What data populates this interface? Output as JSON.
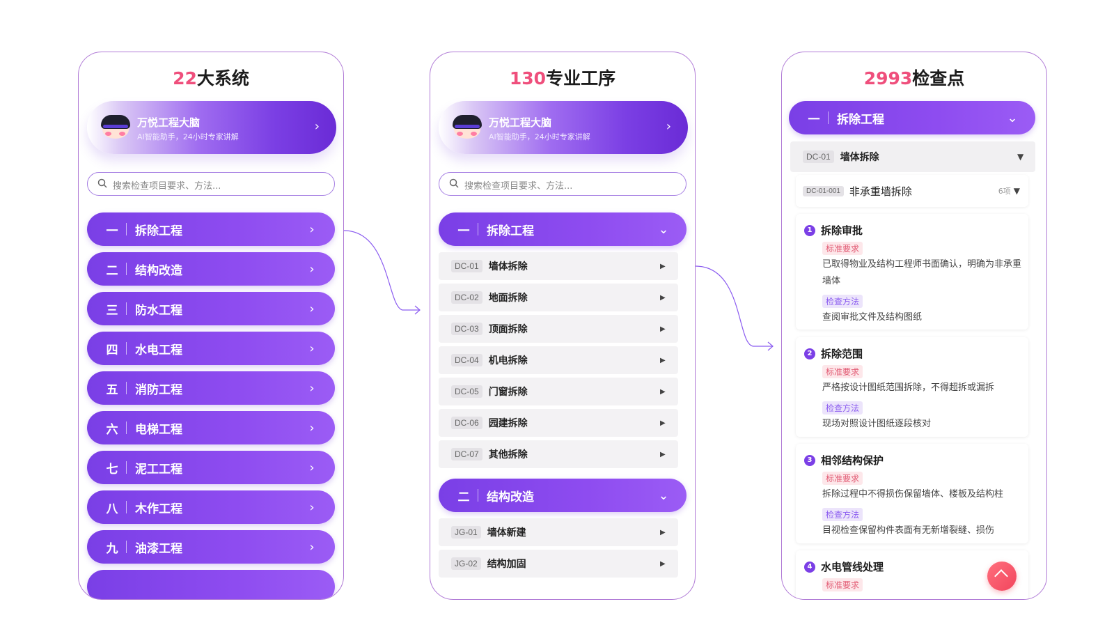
{
  "panels": [
    {
      "title_num": "22",
      "title_text": "大系统",
      "banner": {
        "title": "万悦工程大脑",
        "subtitle": "AI智能助手，24小时专家讲解"
      },
      "search_placeholder": "搜索检查项目要求、方法...",
      "sections": [
        {
          "num": "一",
          "label": "拆除工程"
        },
        {
          "num": "二",
          "label": "结构改造"
        },
        {
          "num": "三",
          "label": "防水工程"
        },
        {
          "num": "四",
          "label": "水电工程"
        },
        {
          "num": "五",
          "label": "消防工程"
        },
        {
          "num": "六",
          "label": "电梯工程"
        },
        {
          "num": "七",
          "label": "泥工工程"
        },
        {
          "num": "八",
          "label": "木作工程"
        },
        {
          "num": "九",
          "label": "油漆工程"
        }
      ]
    },
    {
      "title_num": "130",
      "title_text": "专业工序",
      "banner": {
        "title": "万悦工程大脑",
        "subtitle": "AI智能助手，24小时专家讲解"
      },
      "search_placeholder": "搜索检查项目要求、方法...",
      "section1": {
        "num": "一",
        "label": "拆除工程"
      },
      "items1": [
        {
          "code": "DC-01",
          "label": "墙体拆除"
        },
        {
          "code": "DC-02",
          "label": "地面拆除"
        },
        {
          "code": "DC-03",
          "label": "顶面拆除"
        },
        {
          "code": "DC-04",
          "label": "机电拆除"
        },
        {
          "code": "DC-05",
          "label": "门窗拆除"
        },
        {
          "code": "DC-06",
          "label": "园建拆除"
        },
        {
          "code": "DC-07",
          "label": "其他拆除"
        }
      ],
      "section2": {
        "num": "二",
        "label": "结构改造"
      },
      "items2": [
        {
          "code": "JG-01",
          "label": "墙体新建"
        },
        {
          "code": "JG-02",
          "label": "结构加固"
        }
      ]
    },
    {
      "title_num": "2993",
      "title_text": "检查点",
      "section": {
        "num": "一",
        "label": "拆除工程"
      },
      "process": {
        "code": "DC-01",
        "label": "墙体拆除"
      },
      "subitem": {
        "code": "DC-01-001",
        "label": "非承重墙拆除",
        "count": "6项"
      },
      "std_label": "标准要求",
      "method_label": "检查方法",
      "cards": [
        {
          "no": "1",
          "title": "拆除审批",
          "standard": "已取得物业及结构工程师书面确认，明确为非承重墙体",
          "method": "查阅审批文件及结构图纸"
        },
        {
          "no": "2",
          "title": "拆除范围",
          "standard": "严格按设计图纸范围拆除，不得超拆或漏拆",
          "method": "现场对照设计图纸逐段核对"
        },
        {
          "no": "3",
          "title": "相邻结构保护",
          "standard": "拆除过程中不得损伤保留墙体、楼板及结构柱",
          "method": "目视检查保留构件表面有无新增裂缝、损伤"
        },
        {
          "no": "4",
          "title": "水电管线处理"
        }
      ]
    }
  ],
  "icons": {
    "banner_avatar": "robot-avatar-icon",
    "search": "search-icon",
    "fab": "back-to-top-icon"
  },
  "colors": {
    "accent": "#7b3fe6",
    "title_number": "#ef4f7c",
    "fab": "#f2455d"
  }
}
